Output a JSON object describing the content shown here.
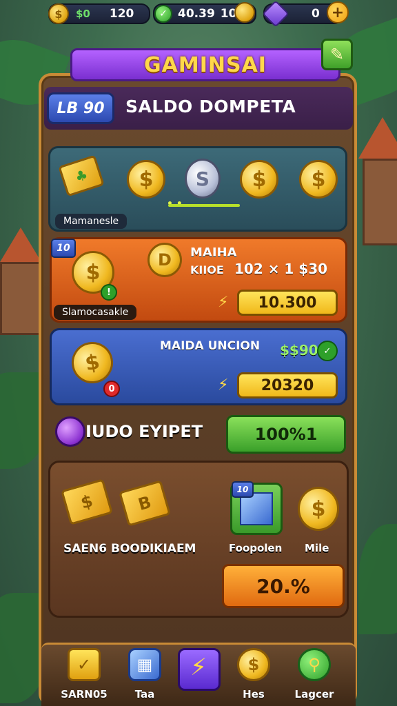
{
  "topbar": {
    "coins_value": "$0",
    "coins_count": "120",
    "gem_value": "40.39",
    "gem_count": "10",
    "purple_count": "0"
  },
  "title": {
    "text": "GAMINSAI",
    "level": "LB 90",
    "subtitle": "SALDO DOMPETA"
  },
  "card_teal": {
    "label": "Mamanesle"
  },
  "card_orange": {
    "badge": "10",
    "title": "MAIHA",
    "sub_left": "KIIOE",
    "sub_right": "102 × 1 $30",
    "label": "Slamocasakle",
    "value": "10.300"
  },
  "card_blue": {
    "title": "MAIDA UNCION",
    "price": "$$90",
    "value": "20320"
  },
  "section": {
    "title": "IUDO EYIPET",
    "button": "100%1"
  },
  "shop": {
    "label_left": "SAEN6 BOODIKIAEM",
    "cube_badge": "10",
    "label_mid": "Foopolen",
    "label_right": "Mile",
    "button": "20.%"
  },
  "bottom_nav": [
    {
      "label": "SARN05",
      "icon": "check-icon"
    },
    {
      "label": "Taa",
      "icon": "cube-icon"
    },
    {
      "label": "",
      "icon": "bolt-icon"
    },
    {
      "label": "Hes",
      "icon": "coin-icon"
    },
    {
      "label": "Lagcer",
      "icon": "magnifier-icon"
    }
  ],
  "colors": {
    "title_purple": "#9a4ae8",
    "gold": "#ffd84a",
    "orange_card": "#e0621e",
    "blue_card": "#3a5cb8",
    "green_button": "#5ac03a"
  }
}
